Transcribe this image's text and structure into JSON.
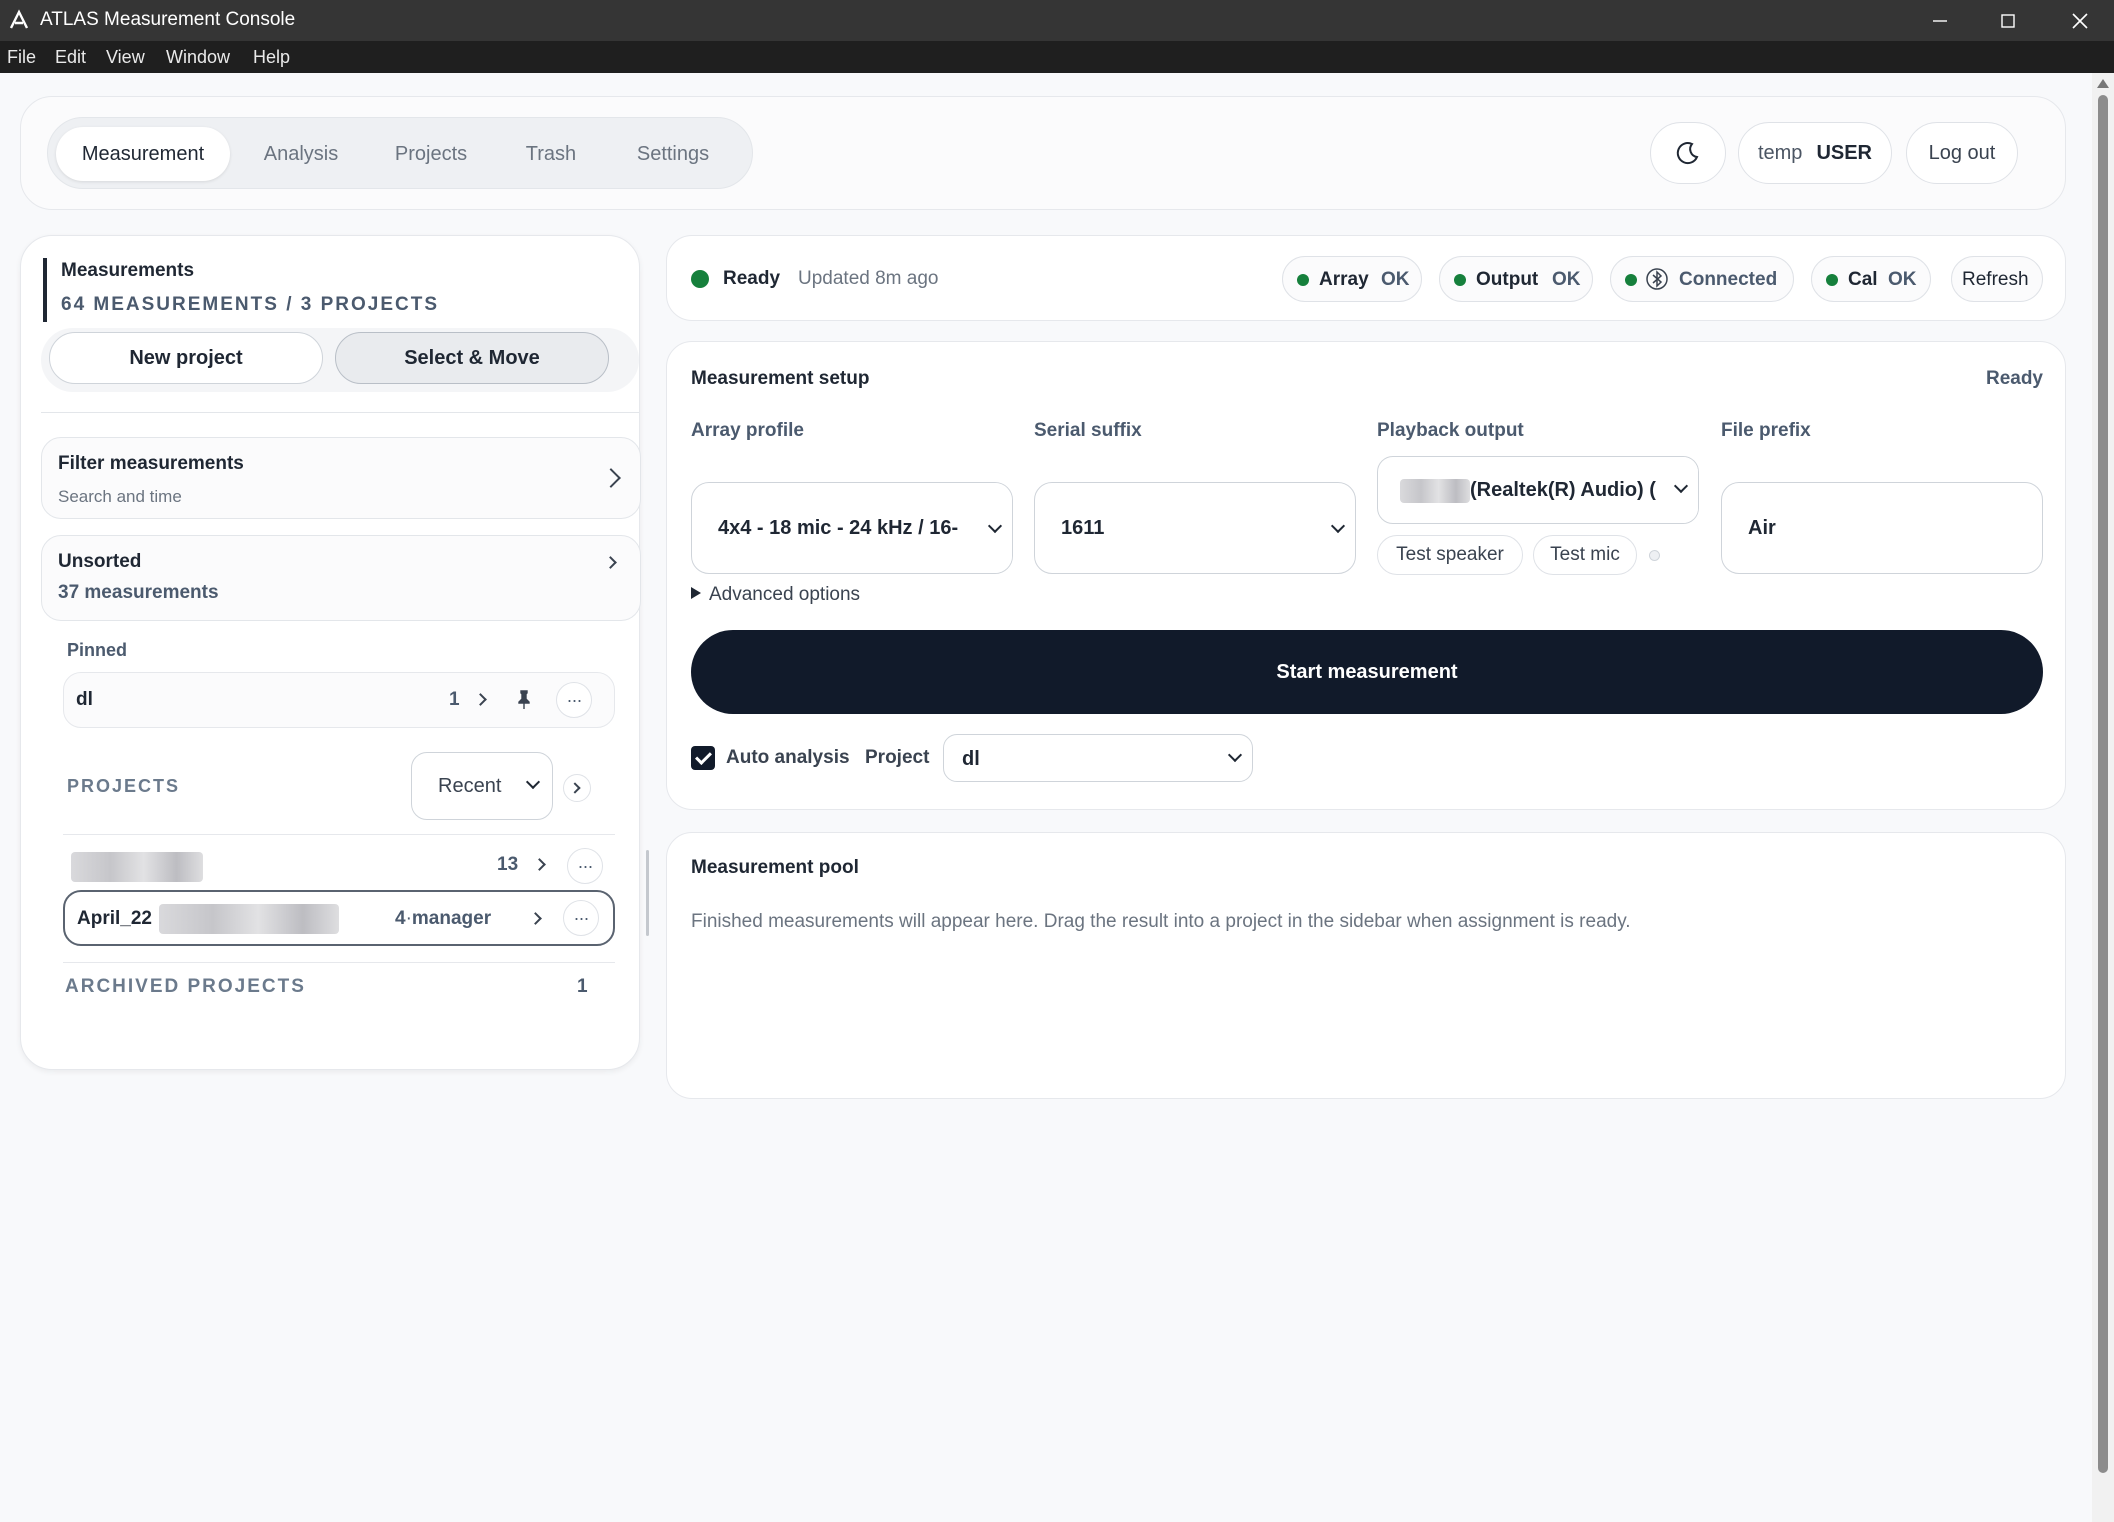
{
  "window": {
    "title": "ATLAS Measurement Console",
    "menu": [
      "File",
      "Edit",
      "View",
      "Window",
      "Help"
    ]
  },
  "nav": {
    "tabs": [
      "Measurement",
      "Analysis",
      "Projects",
      "Trash",
      "Settings"
    ],
    "active_tab": "Measurement",
    "theme_icon": "moon-icon",
    "user_name": "temp",
    "user_role": "USER",
    "logout_label": "Log out"
  },
  "sidebar": {
    "title": "Measurements",
    "subtitle": "64 MEASUREMENTS / 3 PROJECTS",
    "new_project_label": "New project",
    "select_move_label": "Select & Move",
    "filter": {
      "title": "Filter measurements",
      "subtitle": "Search and time"
    },
    "unsorted": {
      "title": "Unsorted",
      "count": "37 measurements"
    },
    "pinned_label": "Pinned",
    "pinned": [
      {
        "name": "dl",
        "count": "1"
      }
    ],
    "projects_label": "PROJECTS",
    "sort_value": "Recent",
    "projects": [
      {
        "name": "",
        "count": "13"
      },
      {
        "name": "April_22",
        "count": "4",
        "owner": "manager"
      }
    ],
    "archived_label": "ARCHIVED PROJECTS",
    "archived_count": "1"
  },
  "status": {
    "state": "Ready",
    "updated": "Updated 8m ago",
    "chips": [
      {
        "label": "Array",
        "value": "OK"
      },
      {
        "label": "Output",
        "value": "OK"
      },
      {
        "label": "Connected",
        "value": ""
      },
      {
        "label": "Cal",
        "value": "OK"
      }
    ],
    "refresh_label": "Refresh",
    "ok_color": "#16803c"
  },
  "setup": {
    "title": "Measurement setup",
    "state": "Ready",
    "array_profile_label": "Array profile",
    "array_profile_value": "4x4 - 18 mic - 24 kHz / 16-",
    "serial_suffix_label": "Serial suffix",
    "serial_suffix_value": "1611",
    "playback_label": "Playback output",
    "playback_value": "(Realtek(R) Audio) (",
    "test_speaker_label": "Test speaker",
    "test_mic_label": "Test mic",
    "file_prefix_label": "File prefix",
    "file_prefix_value": "Air",
    "advanced_label": "Advanced options",
    "start_label": "Start measurement",
    "auto_analysis_label": "Auto analysis",
    "auto_analysis_checked": true,
    "project_label": "Project",
    "project_value": "dl"
  },
  "pool": {
    "title": "Measurement pool",
    "empty_text": "Finished measurements will appear here. Drag the result into a project in the sidebar when assignment is ready."
  }
}
